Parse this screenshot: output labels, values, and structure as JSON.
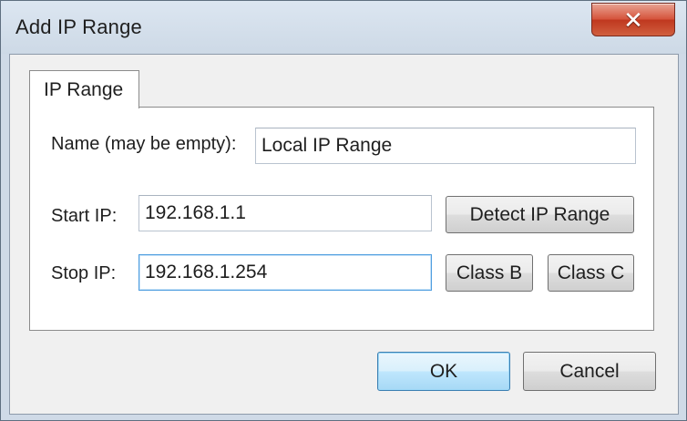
{
  "window": {
    "title": "Add IP Range",
    "close_glyph": "✕"
  },
  "tabs": [
    {
      "label": "IP Range",
      "selected": true
    }
  ],
  "form": {
    "name_label": "Name (may be empty):",
    "name_value": "Local IP Range",
    "start_label": "Start IP:",
    "start_value": "192.168.1.1",
    "stop_label": "Stop IP:",
    "stop_value": "192.168.1.254",
    "detect_button": "Detect IP Range",
    "class_b_button": "Class B",
    "class_c_button": "Class C"
  },
  "footer": {
    "ok_label": "OK",
    "cancel_label": "Cancel"
  },
  "colors": {
    "frame": "#cfdae7",
    "close_button": "#c7462c",
    "focus_border": "#4f9ee0",
    "default_button": "#bee6fd"
  }
}
